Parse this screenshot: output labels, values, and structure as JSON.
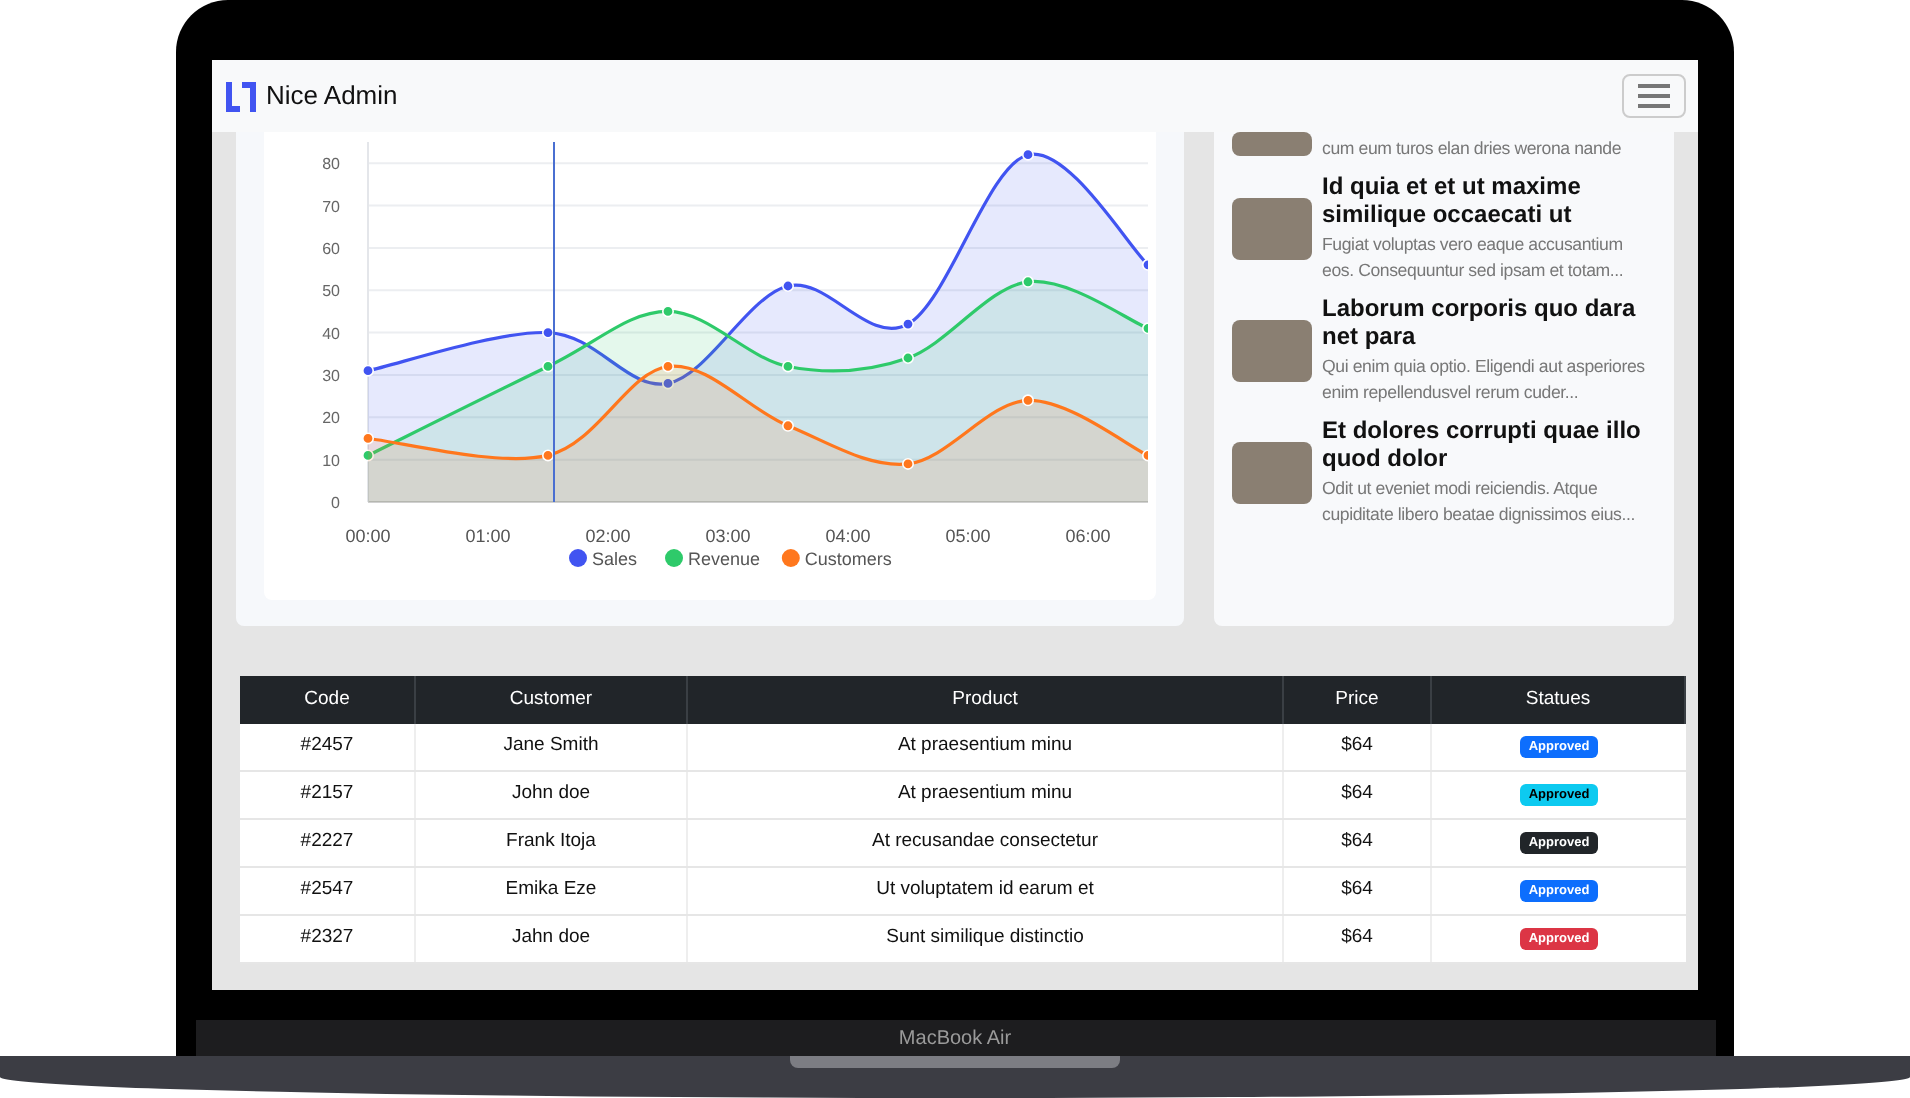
{
  "device": {
    "label": "MacBook Air"
  },
  "header": {
    "logo_text": "Nice Admin"
  },
  "chart": {
    "chart_data": {
      "type": "area",
      "x": [
        0,
        1.5,
        2.5,
        3.5,
        4.5,
        5.5,
        6.5
      ],
      "series": [
        {
          "name": "Sales",
          "color": "#4154f1",
          "values": [
            31,
            40,
            28,
            51,
            42,
            82,
            56
          ]
        },
        {
          "name": "Revenue",
          "color": "#2eca6a",
          "values": [
            11,
            32,
            45,
            32,
            34,
            52,
            41
          ]
        },
        {
          "name": "Customers",
          "color": "#ff771d",
          "values": [
            15,
            11,
            32,
            18,
            9,
            24,
            11
          ]
        }
      ],
      "xticks": [
        {
          "value": 0,
          "label": "00:00"
        },
        {
          "value": 1,
          "label": "01:00"
        },
        {
          "value": 2,
          "label": "02:00"
        },
        {
          "value": 3,
          "label": "03:00"
        },
        {
          "value": 4,
          "label": "04:00"
        },
        {
          "value": 5,
          "label": "05:00"
        },
        {
          "value": 6,
          "label": "06:00"
        }
      ],
      "yticks": [
        0,
        10,
        20,
        30,
        40,
        50,
        60,
        70,
        80
      ],
      "xlim": [
        0,
        6.5
      ],
      "ylim": [
        0,
        85
      ],
      "grid": true,
      "legend": true,
      "ref_lines": [
        {
          "axis": "x",
          "value": 1.55,
          "color": "#4a6fd1"
        }
      ]
    }
  },
  "news": [
    {
      "text": "cum eum turos elan dries werona nande"
    },
    {
      "title": "Id quia et et ut maxime similique occaecati ut",
      "text": "Fugiat voluptas vero eaque accusantium eos. Consequuntur sed ipsam et totam..."
    },
    {
      "title": "Laborum corporis quo dara net para",
      "text": "Qui enim quia optio. Eligendi aut asperiores enim repellendusvel rerum cuder..."
    },
    {
      "title": "Et dolores corrupti quae illo quod dolor",
      "text": "Odit ut eveniet modi reiciendis. Atque cupiditate libero beatae dignissimos eius..."
    }
  ],
  "table": {
    "columns": [
      "Code",
      "Customer",
      "Product",
      "Price",
      "Statues"
    ],
    "rows": [
      {
        "code": "#2457",
        "customer": "Jane Smith",
        "product": "At praesentium minu",
        "price": "$64",
        "status": "Approved",
        "color": "#0d6efd"
      },
      {
        "code": "#2157",
        "customer": "John doe",
        "product": "At praesentium minu",
        "price": "$64",
        "status": "Approved",
        "color": "#0dcaf0"
      },
      {
        "code": "#2227",
        "customer": "Frank Itoja",
        "product": "At recusandae consectetur",
        "price": "$64",
        "status": "Approved",
        "color": "#212529"
      },
      {
        "code": "#2547",
        "customer": "Emika Eze",
        "product": "Ut voluptatem id earum et",
        "price": "$64",
        "status": "Approved",
        "color": "#0d6efd"
      },
      {
        "code": "#2327",
        "customer": "Jahn doe",
        "product": "Sunt similique distinctio",
        "price": "$64",
        "status": "Approved",
        "color": "#dc3545"
      }
    ]
  }
}
